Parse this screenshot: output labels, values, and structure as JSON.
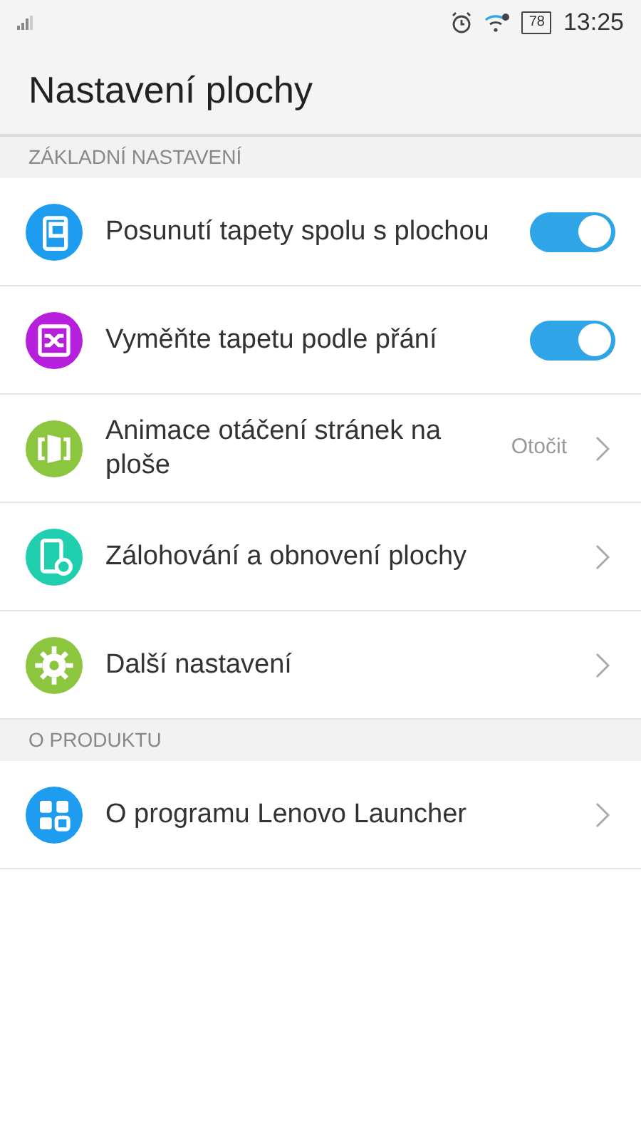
{
  "status_bar": {
    "battery": "78",
    "time": "13:25"
  },
  "title": "Nastavení plochy",
  "sections": [
    {
      "header": "ZÁKLADNÍ NASTAVENÍ",
      "items": [
        {
          "kind": "toggle",
          "label": "Posunutí tapety spolu s plochou",
          "on": true,
          "color": "#1e9df0"
        },
        {
          "kind": "toggle",
          "label": "Vyměňte tapetu podle přání",
          "on": true,
          "color": "#b620dc"
        },
        {
          "kind": "link",
          "label": "Animace otáčení stránek na ploše",
          "value": "Otočit",
          "color": "#8cc63e"
        },
        {
          "kind": "link",
          "label": "Zálohování a obnovení plochy",
          "color": "#1fcfae"
        },
        {
          "kind": "link",
          "label": "Další nastavení",
          "color": "#8cc63e"
        }
      ]
    },
    {
      "header": "O PRODUKTU",
      "items": [
        {
          "kind": "link",
          "label": "O programu Lenovo Launcher",
          "color": "#1e9df0"
        }
      ]
    }
  ]
}
